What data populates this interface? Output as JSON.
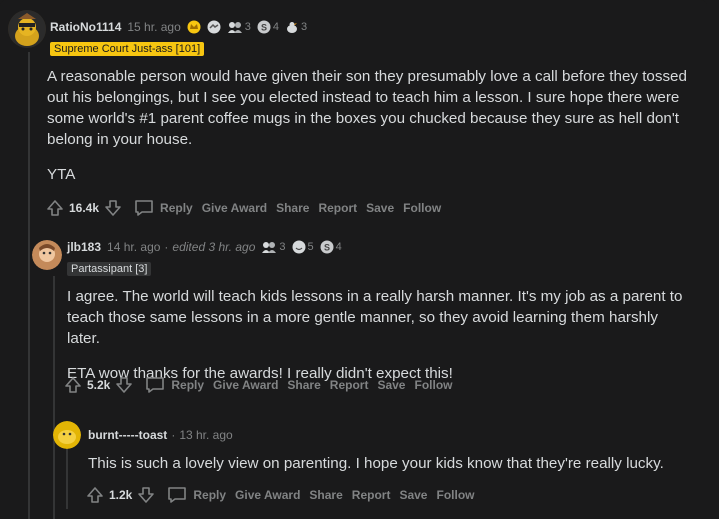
{
  "colors": {
    "background": "#1a1a1b",
    "text": "#d7dadc",
    "muted": "#818384",
    "gold_flair": "#f7c611",
    "dark_flair": "#343536"
  },
  "comments": [
    {
      "username": "RatioNo1114",
      "time": "15 hr. ago",
      "awards": [
        {
          "icon": "gold-crown-award-icon",
          "count": ""
        },
        {
          "icon": "handshake-award-icon",
          "count": ""
        },
        {
          "icon": "people-award-icon",
          "count": "3"
        },
        {
          "icon": "silver-coin-award-icon",
          "count": "4"
        },
        {
          "icon": "bird-award-icon",
          "count": "3"
        }
      ],
      "flair": "Supreme Court Just-ass [101]",
      "body": [
        "A reasonable person would have given their son they presumably love a call before they tossed out his belongings, but I see you elected instead to teach him a lesson. I sure hope there were some world's #1 parent coffee mugs in the boxes you chucked because they sure as hell don't belong in your house.",
        "YTA"
      ],
      "score": "16.4k",
      "actions": [
        "Reply",
        "Give Award",
        "Share",
        "Report",
        "Save",
        "Follow"
      ]
    },
    {
      "username": "jlb183",
      "time": "14 hr. ago",
      "edited": "edited 3 hr. ago",
      "awards": [
        {
          "icon": "people-award-icon",
          "count": "3"
        },
        {
          "icon": "face-award-icon",
          "count": "5"
        },
        {
          "icon": "silver-coin-award-icon",
          "count": "4"
        }
      ],
      "flair": "Partassipant [3]",
      "body": [
        "I agree. The world will teach kids lessons in a really harsh manner. It's my job as a parent to teach those same lessons in a more gentle manner, so they avoid learning them harshly later.",
        "ETA wow thanks for the awards! I really didn't expect this!"
      ],
      "score": "5.2k",
      "actions": [
        "Reply",
        "Give Award",
        "Share",
        "Report",
        "Save",
        "Follow"
      ]
    },
    {
      "username": "burnt-----toast",
      "time": "13 hr. ago",
      "body": [
        "This is such a lovely view on parenting. I hope your kids know that they're really lucky."
      ],
      "score": "1.2k",
      "actions": [
        "Reply",
        "Give Award",
        "Share",
        "Report",
        "Save",
        "Follow"
      ]
    }
  ]
}
